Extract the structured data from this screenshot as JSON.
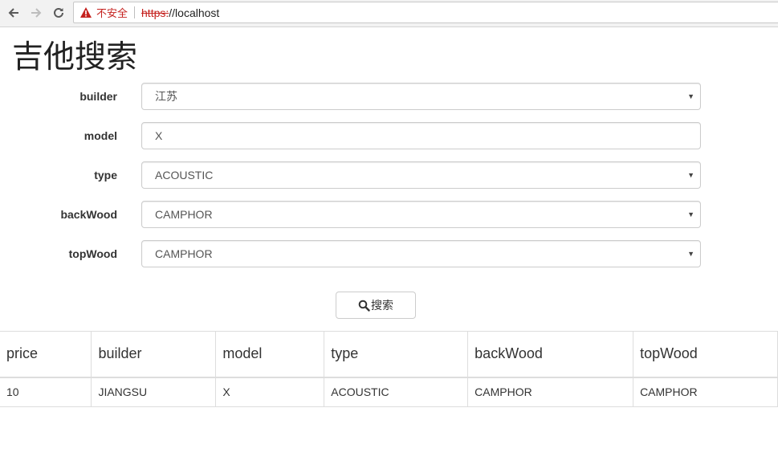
{
  "browser": {
    "security_label": "不安全",
    "url_scheme": "https:",
    "url_rest": "//localhost"
  },
  "page": {
    "title": "吉他搜索"
  },
  "form": {
    "builder": {
      "label": "builder",
      "value": "江苏"
    },
    "model": {
      "label": "model",
      "value": "X"
    },
    "type": {
      "label": "type",
      "value": "ACOUSTIC"
    },
    "backWood": {
      "label": "backWood",
      "value": "CAMPHOR"
    },
    "topWood": {
      "label": "topWood",
      "value": "CAMPHOR"
    },
    "search_button": "搜索"
  },
  "results": {
    "columns": [
      "price",
      "builder",
      "model",
      "type",
      "backWood",
      "topWood"
    ],
    "rows": [
      [
        "10",
        "JIANGSU",
        "X",
        "ACOUSTIC",
        "CAMPHOR",
        "CAMPHOR"
      ]
    ]
  },
  "colors": {
    "insecure_red": "#c5221f",
    "border_gray": "#ccc"
  }
}
